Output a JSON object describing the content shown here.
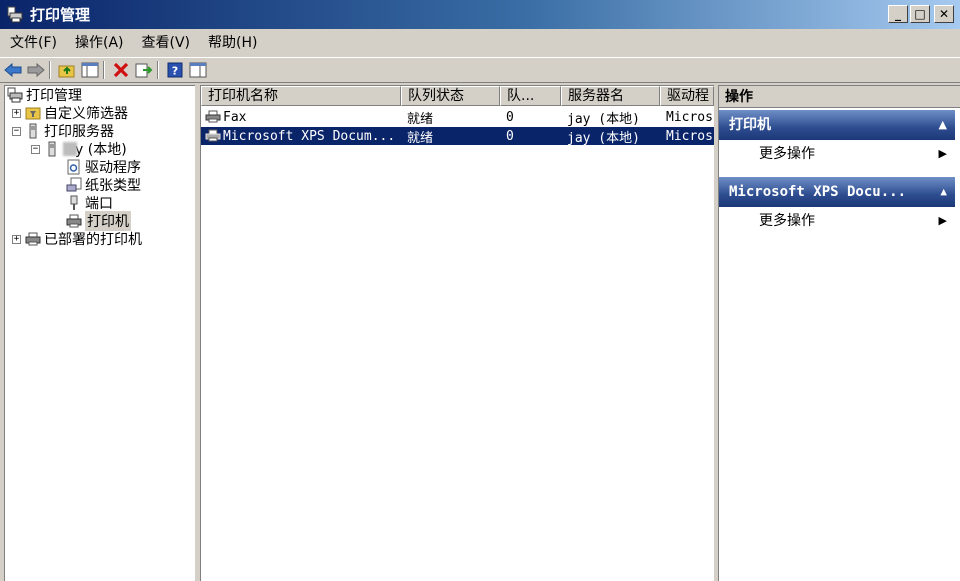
{
  "window": {
    "title": "打印管理",
    "minimize_glyph": "_",
    "maximize_glyph": "□",
    "close_glyph": "✕"
  },
  "menu": [
    {
      "label": "文件(F)"
    },
    {
      "label": "操作(A)"
    },
    {
      "label": "查看(V)"
    },
    {
      "label": "帮助(H)"
    }
  ],
  "toolbar": {
    "icons": [
      "back-arrow-icon",
      "forward-arrow-icon",
      "up-folder-icon",
      "show-hide-tree-icon",
      "delete-icon",
      "export-list-icon",
      "help-icon",
      "show-hide-action-pane-icon"
    ]
  },
  "tree": {
    "root": "打印管理",
    "custom_filters": "自定义筛选器",
    "print_servers": "打印服务器",
    "server_local": "y (本地)",
    "drivers": "驱动程序",
    "forms": "纸张类型",
    "ports": "端口",
    "printers": "打印机",
    "deployed_printers": "已部署的打印机",
    "expand_glyph": "+",
    "collapse_glyph": "−"
  },
  "list": {
    "columns": [
      "打印机名称",
      "队列状态",
      "队...",
      "服务器名",
      "驱动程"
    ],
    "rows": [
      {
        "name": "Fax",
        "status": "就绪",
        "jobs": "0",
        "server": "jay (本地)",
        "driver": "Micros"
      },
      {
        "name": "Microsoft XPS Docum...",
        "status": "就绪",
        "jobs": "0",
        "server": "jay (本地)",
        "driver": "Micros"
      }
    ]
  },
  "actions": {
    "header": "操作",
    "sections": [
      {
        "title": "打印机",
        "items": [
          {
            "label": "更多操作"
          }
        ]
      },
      {
        "title": "Microsoft XPS Docu...",
        "items": [
          {
            "label": "更多操作"
          }
        ]
      }
    ],
    "collapse_glyph": "▲",
    "submenu_glyph": "▶"
  },
  "colors": {
    "selection": "#0a246a",
    "section_header": "#2d4c8f",
    "chrome": "#d4d0c8"
  }
}
